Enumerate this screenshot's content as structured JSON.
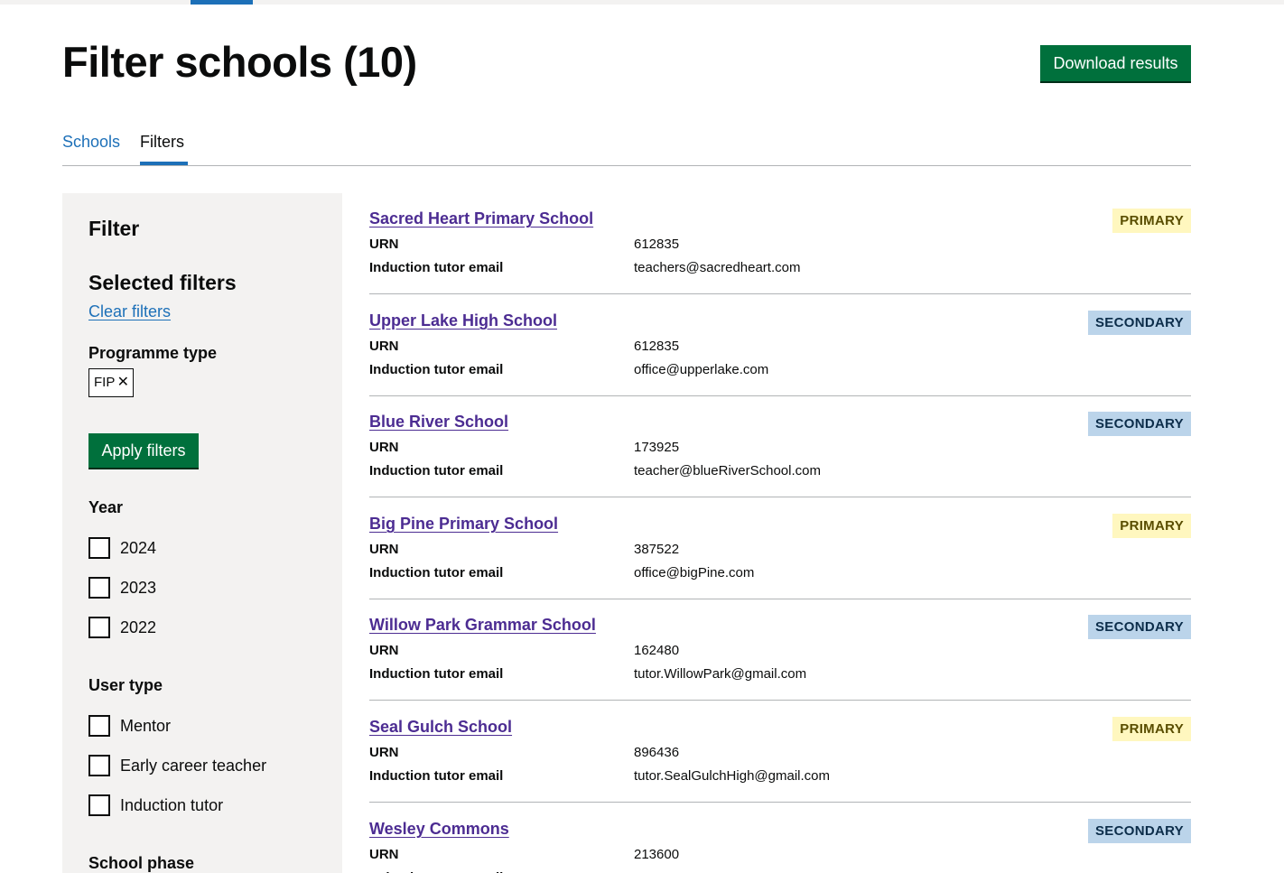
{
  "title": "Filter schools (10)",
  "download_label": "Download results",
  "tabs": [
    "Schools",
    "Filters"
  ],
  "filter": {
    "heading": "Filter",
    "selected_heading": "Selected filters",
    "clear_label": "Clear filters",
    "programme_type_label": "Programme type",
    "programme_tag": "FIP",
    "remove_glyph": "✕",
    "apply_label": "Apply filters",
    "year_label": "Year",
    "years": [
      "2024",
      "2023",
      "2022"
    ],
    "user_type_label": "User type",
    "user_types": [
      "Mentor",
      "Early career teacher",
      "Induction tutor"
    ],
    "school_phase_label": "School phase"
  },
  "row_labels": {
    "urn": "URN",
    "email": "Induction tutor email"
  },
  "schools": [
    {
      "name": "Sacred Heart Primary School",
      "urn": "612835",
      "email": "teachers@sacredheart.com",
      "phase": "PRIMARY"
    },
    {
      "name": "Upper Lake High School",
      "urn": "612835",
      "email": "office@upperlake.com",
      "phase": "SECONDARY"
    },
    {
      "name": "Blue River School",
      "urn": "173925",
      "email": "teacher@blueRiverSchool.com",
      "phase": "SECONDARY"
    },
    {
      "name": "Big Pine Primary School",
      "urn": "387522",
      "email": "office@bigPine.com",
      "phase": "PRIMARY"
    },
    {
      "name": "Willow Park Grammar School",
      "urn": "162480",
      "email": "tutor.WillowPark@gmail.com",
      "phase": "SECONDARY"
    },
    {
      "name": "Seal Gulch School",
      "urn": "896436",
      "email": "tutor.SealGulchHigh@gmail.com",
      "phase": "PRIMARY"
    },
    {
      "name": "Wesley Commons",
      "urn": "213600",
      "email": "",
      "phase": "SECONDARY"
    }
  ],
  "colors": {
    "brand_green": "#00703c",
    "link_blue": "#1d70b8",
    "visited_link": "#4c2c92",
    "panel_grey": "#f3f2f1",
    "primary_tag_bg": "#fff7bf",
    "secondary_tag_bg": "#bbd4ea"
  }
}
